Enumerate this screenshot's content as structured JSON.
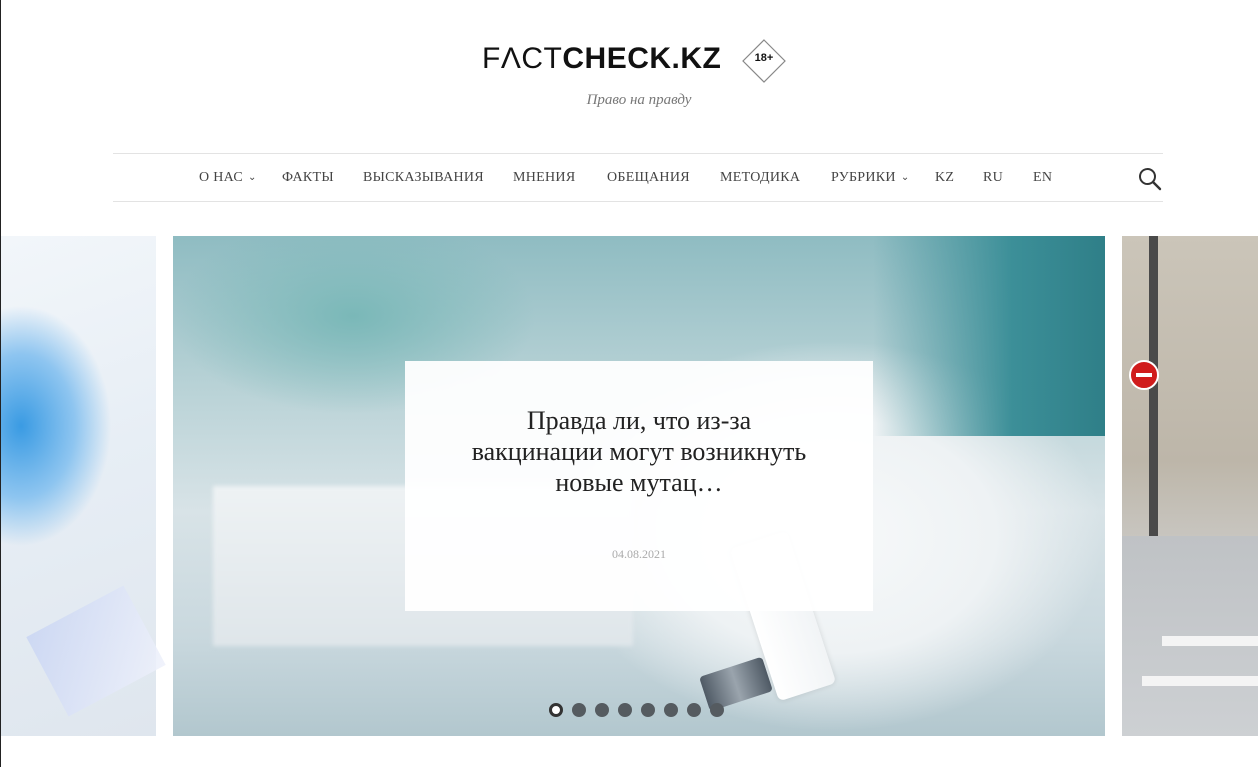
{
  "header": {
    "logo_part1": "FΛCT",
    "logo_part2": "CHECK.KZ",
    "age_badge": "18+",
    "tagline": "Право на правду"
  },
  "nav": {
    "items": [
      {
        "label": "О НАС",
        "has_dropdown": true
      },
      {
        "label": "ФАКТЫ",
        "has_dropdown": false
      },
      {
        "label": "ВЫСКАЗЫВАНИЯ",
        "has_dropdown": false
      },
      {
        "label": "МНЕНИЯ",
        "has_dropdown": false
      },
      {
        "label": "ОБЕЩАНИЯ",
        "has_dropdown": false
      },
      {
        "label": "МЕТОДИКА",
        "has_dropdown": false
      },
      {
        "label": "РУБРИКИ",
        "has_dropdown": true
      },
      {
        "label": "KZ",
        "has_dropdown": false
      },
      {
        "label": "RU",
        "has_dropdown": false
      },
      {
        "label": "EN",
        "has_dropdown": false
      }
    ],
    "search_icon": "search-icon",
    "chevron": "⌄"
  },
  "slider": {
    "current_slide": {
      "title": "Правда ли, что из-за вакцинации могут возникнуть новые мутац…",
      "date": "04.08.2021"
    },
    "dot_count": 8,
    "active_dot": 1
  },
  "colors": {
    "text": "#444444",
    "tagline": "#777777",
    "nav_border": "#e3e3e3",
    "dot": "#555b60"
  }
}
